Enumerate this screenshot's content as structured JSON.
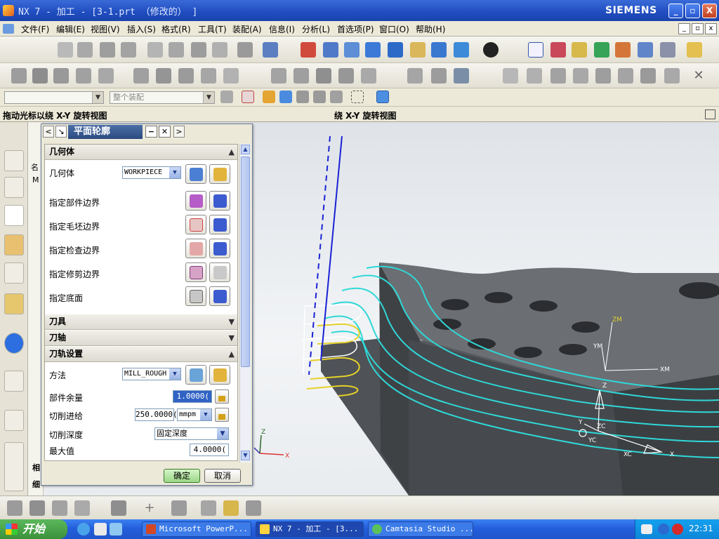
{
  "window": {
    "title": "NX 7 - 加工 - [3-1.prt （修改的） ]",
    "brand": "SIEMENS",
    "minimize": "_",
    "maximize": "▫",
    "close": "X"
  },
  "menu": {
    "items": [
      "文件(F)",
      "编辑(E)",
      "视图(V)",
      "插入(S)",
      "格式(R)",
      "工具(T)",
      "装配(A)",
      "信息(I)",
      "分析(L)",
      "首选项(P)",
      "窗口(O)",
      "帮助(H)"
    ]
  },
  "toolbar": {
    "start_label": "开始",
    "selection_filter_placeholder": "",
    "assembly_scope": "整个装配"
  },
  "cue": {
    "prompt": "拖动光标以绕 X-Y 旋转视图",
    "status": "绕 X-Y 旋转视图"
  },
  "dialog": {
    "title": "平面轮廓",
    "sections": {
      "geometry": "几何体",
      "tool": "刀具",
      "tool_axis": "刀轴",
      "path_settings": "刀轨设置"
    },
    "geometry": {
      "label": "几何体",
      "value": "WORKPIECE",
      "rows": [
        "指定部件边界",
        "指定毛坯边界",
        "指定检查边界",
        "指定修剪边界",
        "指定底面"
      ]
    },
    "path": {
      "method_label": "方法",
      "method_value": "MILL_ROUGH",
      "stock_label": "部件余量",
      "stock_value": "1.0000(",
      "feed_label": "切削进给",
      "feed_value": "250.0000(",
      "feed_unit": "mmpm",
      "depth_label": "切削深度",
      "depth_value": "固定深度",
      "max_label": "最大值",
      "max_value": "4.0000("
    },
    "ok": "确定",
    "cancel": "取消"
  },
  "viewport": {
    "axes_top": {
      "z": "ZM",
      "y": "YM",
      "x": "XM"
    },
    "axes_wcs": {
      "z": "Z",
      "y": "Y",
      "zc": "ZC",
      "yc": "YC",
      "xc": "XC",
      "x": "X"
    },
    "triad": {
      "z": "Z",
      "x": "X"
    }
  },
  "nav_panel": {
    "top_char": "名",
    "m_char": "M",
    "bottom_chars": [
      "相",
      "细"
    ]
  },
  "taskbar": {
    "start": "开始",
    "tasks": [
      "Microsoft PowerP...",
      "NX 7 - 加工 - [3...",
      "Camtasia Studio ..."
    ],
    "clock": "22:31"
  },
  "colors": {
    "toolpath": "#2fd8d8",
    "yellow_path": "#e6d12a",
    "tool_axis": "#1a22d4",
    "part": "#5a5e62",
    "part_top": "#6d7175"
  }
}
